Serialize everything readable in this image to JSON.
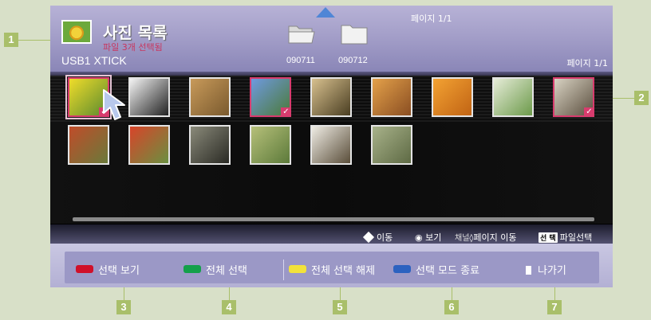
{
  "header": {
    "title": "사진 목록",
    "subtitle": "파일 3개 선택됨",
    "device": "USB1 XTICK",
    "page_top": "페이지 1/1",
    "page_right": "페이지 1/1",
    "folders": [
      "090711",
      "090712"
    ]
  },
  "thumbnails": [
    {
      "name": "butterfly",
      "selected": true,
      "focused": true,
      "c1": "#f0dc2a",
      "c2": "#5a8a2e"
    },
    {
      "name": "ink-painting",
      "selected": false,
      "c1": "#f4f4f4",
      "c2": "#222222"
    },
    {
      "name": "bookshelf",
      "selected": false,
      "c1": "#c89a5a",
      "c2": "#7a5a2e"
    },
    {
      "name": "blue-flowers",
      "selected": true,
      "c1": "#6e9adf",
      "c2": "#4c7a3a"
    },
    {
      "name": "sunset",
      "selected": false,
      "c1": "#d7c08e",
      "c2": "#4a3e22"
    },
    {
      "name": "autumn-tree",
      "selected": false,
      "c1": "#e4a14a",
      "c2": "#8a4e22"
    },
    {
      "name": "oranges",
      "selected": false,
      "c1": "#f3a233",
      "c2": "#c16414"
    },
    {
      "name": "dandelion",
      "selected": false,
      "c1": "#e6ecd8",
      "c2": "#6c9a4a"
    },
    {
      "name": "pebbles",
      "selected": true,
      "c1": "#d8d2c2",
      "c2": "#5c5040"
    },
    {
      "name": "red-berries",
      "selected": false,
      "c1": "#c04c2a",
      "c2": "#6a7a3a"
    },
    {
      "name": "red-rose",
      "selected": false,
      "c1": "#d8442a",
      "c2": "#6a9040"
    },
    {
      "name": "stone-pot",
      "selected": false,
      "c1": "#8a8a7a",
      "c2": "#2a2a24"
    },
    {
      "name": "park",
      "selected": false,
      "c1": "#b6c07a",
      "c2": "#5c7a3a"
    },
    {
      "name": "hallway",
      "selected": false,
      "c1": "#efece4",
      "c2": "#5a4e3a"
    },
    {
      "name": "forest",
      "selected": false,
      "c1": "#a8b28a",
      "c2": "#5e6a44"
    }
  ],
  "hints": {
    "move": "이동",
    "view": "보기",
    "channel": "채널",
    "page_move": "페이지 이동",
    "select_badge": "선 택",
    "file_select": "파일선택"
  },
  "footer": {
    "view_selected": "선택 보기",
    "select_all": "전체 선택",
    "deselect_all": "전체 선택 해제",
    "exit_select_mode": "선택 모드 종료",
    "exit": "나가기",
    "colors": {
      "red": "#d0102a",
      "green": "#14a04a",
      "yellow": "#f2e23a",
      "blue": "#2c62c0"
    }
  },
  "callouts": [
    "1",
    "2",
    "3",
    "4",
    "5",
    "6",
    "7"
  ]
}
